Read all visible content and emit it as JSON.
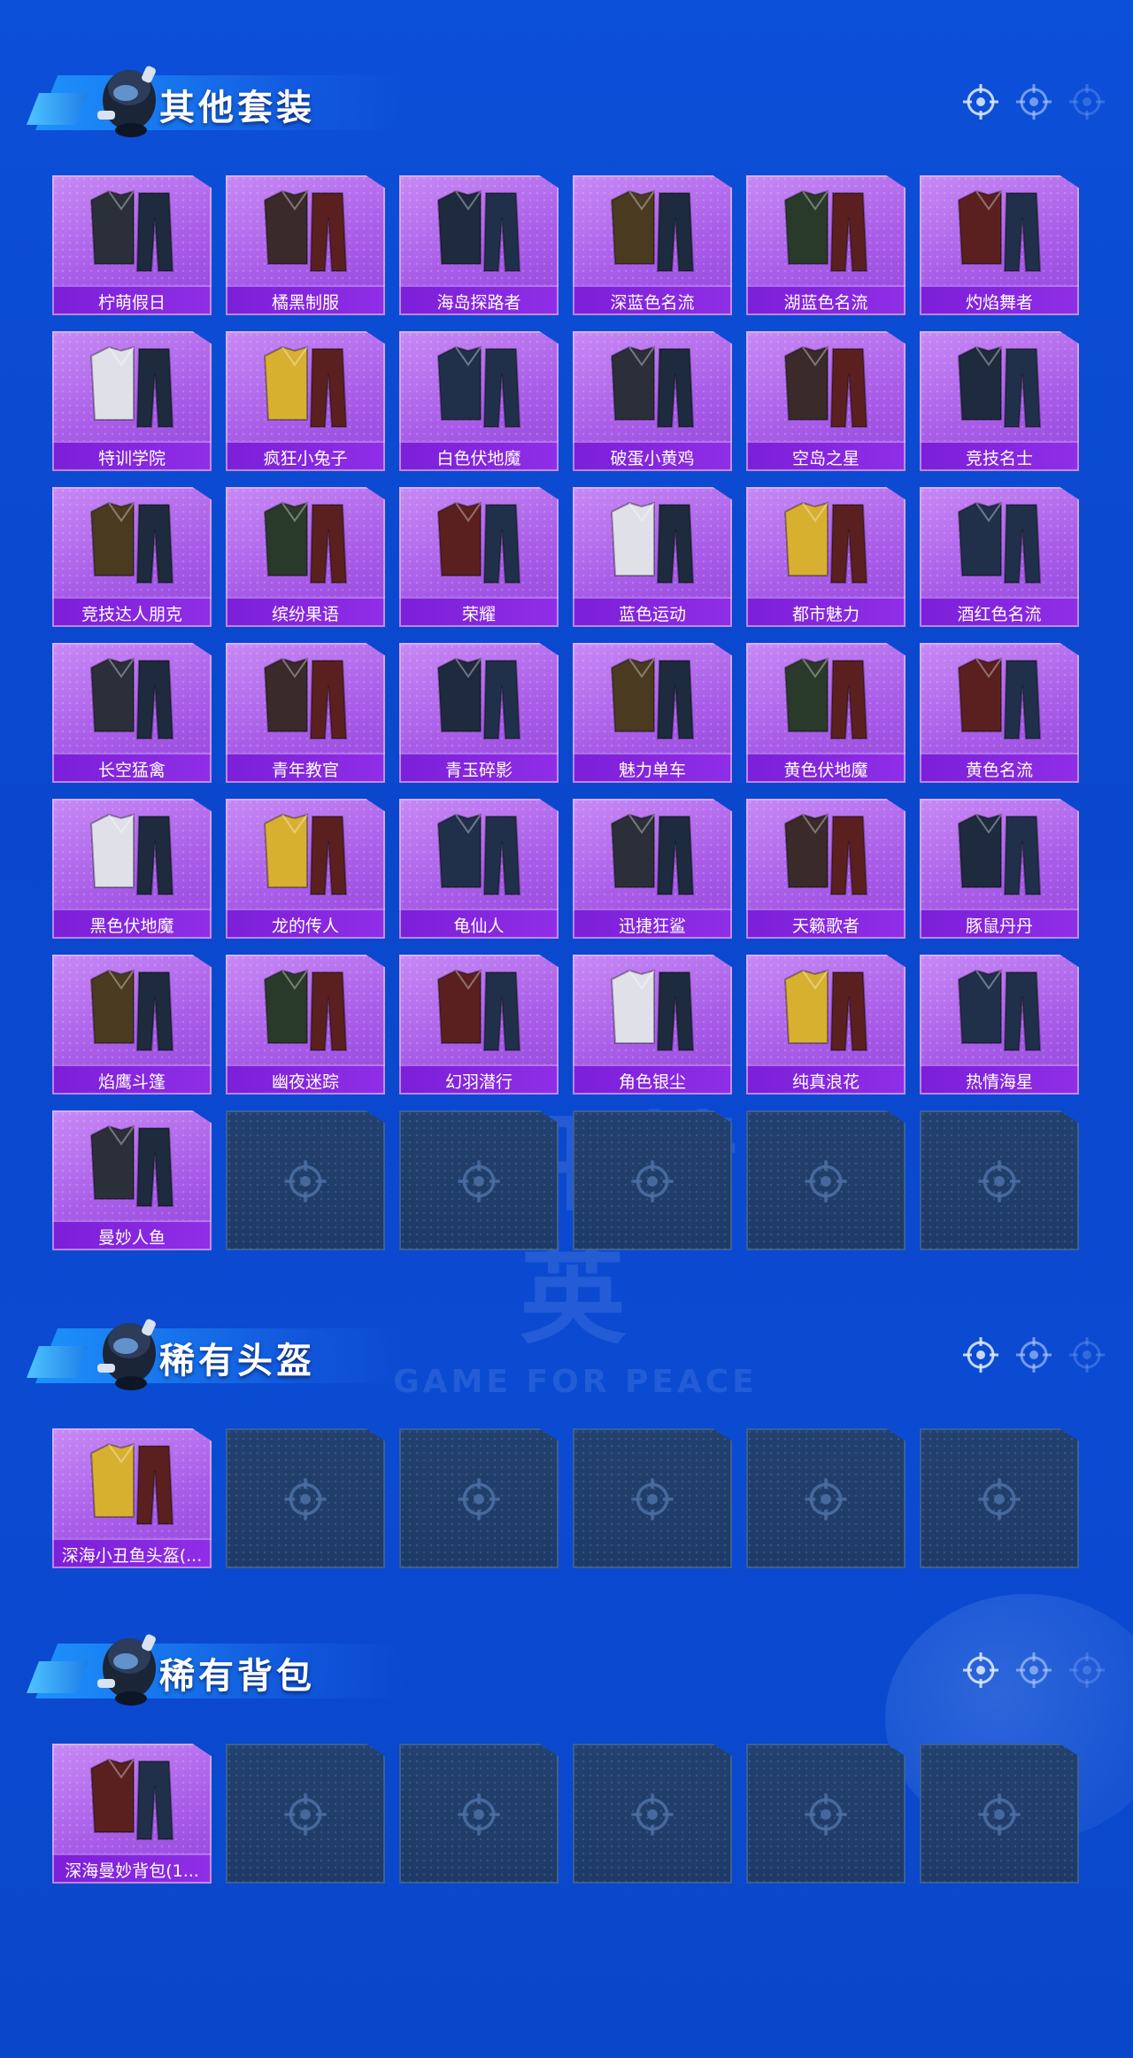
{
  "colors": {
    "background": "#0c4fd8",
    "tile_purple": "#a95de8",
    "label_bar": "#7c1fd8",
    "empty_tile": "#1e3a66"
  },
  "watermark": {
    "text": "和平精英",
    "subtext": "GAME FOR PEACE"
  },
  "sections": [
    {
      "title": "其他套装",
      "icon": "mascot-icon",
      "items": [
        "柠萌假日",
        "橘黑制服",
        "海岛探路者",
        "深蓝色名流",
        "湖蓝色名流",
        "灼焰舞者",
        "特训学院",
        "疯狂小兔子",
        "白色伏地魔",
        "破蛋小黄鸡",
        "空岛之星",
        "竞技名士",
        "竞技达人朋克",
        "缤纷果语",
        "荣耀",
        "蓝色运动",
        "都市魅力",
        "酒红色名流",
        "长空猛禽",
        "青年教官",
        "青玉碎影",
        "魅力单车",
        "黄色伏地魔",
        "黄色名流",
        "黑色伏地魔",
        "龙的传人",
        "龟仙人",
        "迅捷狂鲨",
        "天籁歌者",
        "豚鼠丹丹",
        "焰鹰斗篷",
        "幽夜迷踪",
        "幻羽潜行",
        "角色银尘",
        "纯真浪花",
        "热情海星",
        "曼妙人鱼"
      ],
      "empty_slots": 5
    },
    {
      "title": "稀有头盔",
      "icon": "mascot-icon",
      "items": [
        "深海小丑鱼头盔(..."
      ],
      "empty_slots": 5
    },
    {
      "title": "稀有背包",
      "icon": "mascot-icon",
      "items": [
        "深海曼妙背包(1..."
      ],
      "empty_slots": 5
    }
  ]
}
